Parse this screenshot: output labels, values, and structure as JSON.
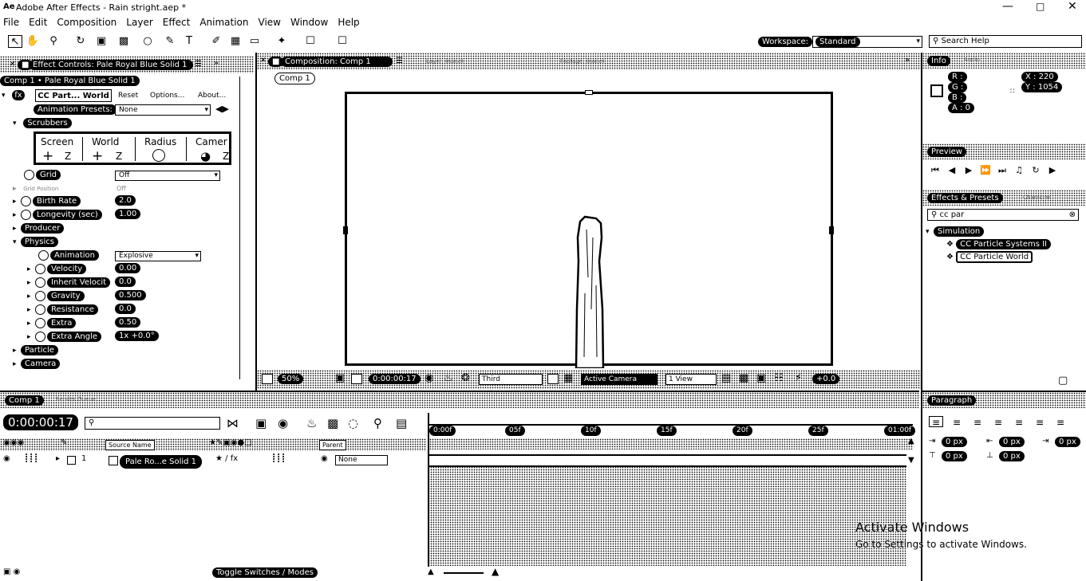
{
  "window": {
    "title": "Adobe After Effects - Rain stright.aep *",
    "app_icon": "Ae",
    "controls": [
      "minimize-icon",
      "maximize-icon",
      "close-icon"
    ]
  },
  "menu": [
    "File",
    "Edit",
    "Composition",
    "Layer",
    "Effect",
    "Animation",
    "View",
    "Window",
    "Help"
  ],
  "toolbar": {
    "workspace_label": "Workspace:",
    "workspace_value": "Standard",
    "search_placeholder": "Search Help"
  },
  "effect_controls": {
    "tab": "Effect Controls: Pale Royal Blue Solid 1",
    "header": "Comp 1 • Pale Royal Blue Solid 1",
    "effect_name": "CC Part... World",
    "reset": "Reset",
    "options": "Options...",
    "about": "About...",
    "presets_label": "Animation Presets:",
    "presets_value": "None",
    "scrubbers_label": "Scrubbers",
    "scrubbers": {
      "screen": "Screen",
      "world": "World",
      "radius": "Radius",
      "camera": "Camer",
      "z": "Z"
    },
    "grid_label": "Grid",
    "grid_value": "Off",
    "hidden_row_label": "Grid Position",
    "hidden_row_value": "Off",
    "birth_rate_label": "Birth Rate",
    "birth_rate_value": "2.0",
    "longevity_label": "Longevity (sec)",
    "longevity_value": "1.00",
    "producer_label": "Producer",
    "physics_label": "Physics",
    "animation_label": "Animation",
    "animation_value": "Explosive",
    "velocity_label": "Velocity",
    "velocity_value": "0.00",
    "inherit_label": "Inherit Velocit",
    "inherit_value": "0.0",
    "gravity_label": "Gravity",
    "gravity_value": "0.500",
    "resistance_label": "Resistance",
    "resistance_value": "0.0",
    "extra_label": "Extra",
    "extra_value": "0.50",
    "extra_angle_label": "Extra Angle",
    "extra_angle_value": "1x +0.0°",
    "particle_label": "Particle",
    "camera_label": "Camera"
  },
  "composition": {
    "tab": "Composition: Comp 1",
    "tab2": "Layer: (none)",
    "tab3": "Footage: (none)",
    "comp_button": "Comp 1",
    "footer": {
      "zoom": "50%",
      "timecode": "0:00:00:17",
      "resolution": "Third",
      "view": "Active Camera",
      "views": "1 View",
      "exposure": "+0.0"
    }
  },
  "info": {
    "tab": "Info",
    "tab2": "Audio",
    "r": "R :",
    "g": "G :",
    "b": "B :",
    "a": "A : 0",
    "x": "X : 220",
    "y": "Y : 1054"
  },
  "preview": {
    "tab": "Preview"
  },
  "effects_presets": {
    "tab": "Effects & Presets",
    "tab2": "Character",
    "search_value": "cc par",
    "category": "Simulation",
    "items": [
      "CC Particle Systems II",
      "CC Particle World"
    ]
  },
  "timeline": {
    "tab": "Comp 1",
    "tab2": "Render Queue",
    "timecode": "0:00:00:17",
    "search_placeholder": "",
    "col_source": "Source Name",
    "col_parent": "Parent",
    "layer_name": "Pale Ro...e Solid 1",
    "layer_parent": "None",
    "ruler": [
      "0:00f",
      "05f",
      "10f",
      "15f",
      "20f",
      "25f",
      "01:00f"
    ],
    "footer": "Toggle Switches / Modes"
  },
  "paragraph": {
    "tab": "Paragraph",
    "indent_values": [
      "0 px",
      "0 px",
      "0 px",
      "0 px",
      "0 px"
    ]
  },
  "watermark": {
    "line1": "Activate Windows",
    "line2": "Go to Settings to activate Windows."
  }
}
